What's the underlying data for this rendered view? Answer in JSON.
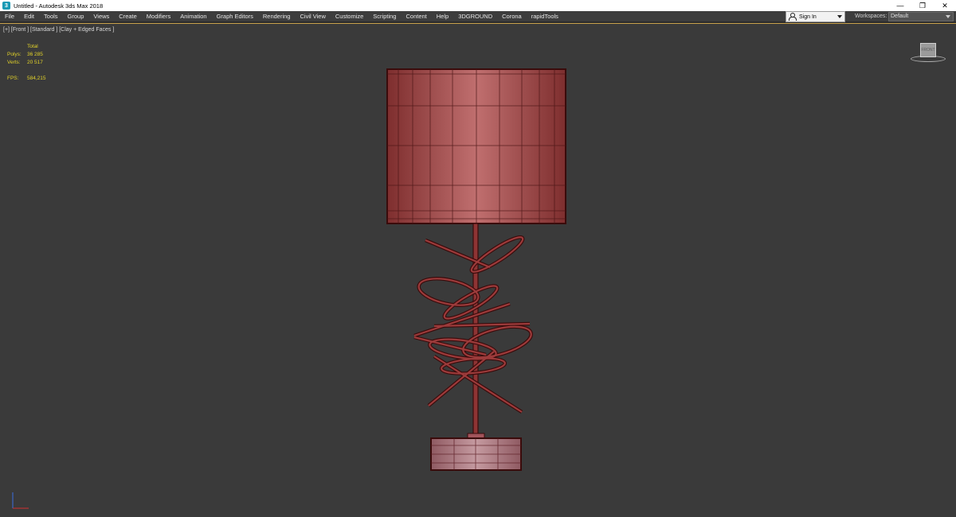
{
  "window": {
    "title": "Untitled - Autodesk 3ds Max 2018",
    "icon": "3ds-max-icon",
    "controls": [
      "—",
      "❐",
      "✕"
    ]
  },
  "menu": {
    "items": [
      "File",
      "Edit",
      "Tools",
      "Group",
      "Views",
      "Create",
      "Modifiers",
      "Animation",
      "Graph Editors",
      "Rendering",
      "Civil View",
      "Customize",
      "Scripting",
      "Content",
      "Help",
      "3DGROUND",
      "Corona",
      "rapidTools"
    ],
    "sign_in": "Sign In",
    "workspaces_label": "Workspaces:",
    "workspace_value": "Default"
  },
  "viewport": {
    "label": "[+] [Front ] [Standard ] [Clay + Edged Faces ]",
    "stats": {
      "total_label": "Total",
      "polys_label": "Polys:",
      "polys_value": "36 285",
      "verts_label": "Verts:",
      "verts_value": "20 517",
      "fps_label": "FPS:",
      "fps_value": "584,215"
    },
    "viewcube_face": "FRONT",
    "model_color": "#9a3a3a",
    "wire_color": "#3a0b0b"
  }
}
